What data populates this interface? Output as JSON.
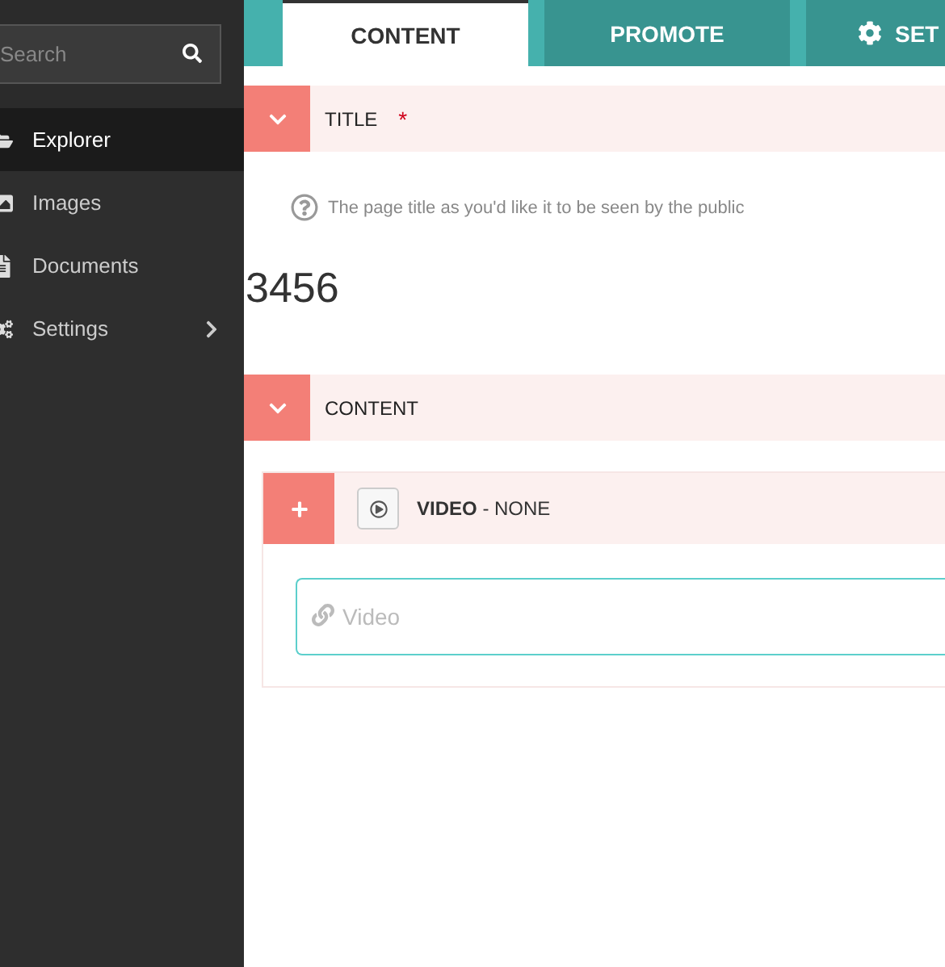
{
  "sidebar": {
    "search": {
      "placeholder": "Search"
    },
    "items": [
      {
        "label": "Explorer",
        "selected": true,
        "has_submenu": false
      },
      {
        "label": "Images",
        "selected": false,
        "has_submenu": false
      },
      {
        "label": "Documents",
        "selected": false,
        "has_submenu": false
      },
      {
        "label": "Settings",
        "selected": false,
        "has_submenu": true
      }
    ]
  },
  "tabs": [
    {
      "label": "CONTENT",
      "selected": true
    },
    {
      "label": "PROMOTE",
      "selected": false
    },
    {
      "label": "SET",
      "selected": false
    }
  ],
  "title_section": {
    "label": "TITLE",
    "required_mark": "*",
    "expanded": true,
    "help": "The page title as you'd like it to be seen by the public",
    "value": "3456"
  },
  "content_section": {
    "label": "CONTENT",
    "expanded": true,
    "block": {
      "name": "VIDEO",
      "status": "- NONE",
      "field": {
        "placeholder": "Video"
      }
    }
  }
}
